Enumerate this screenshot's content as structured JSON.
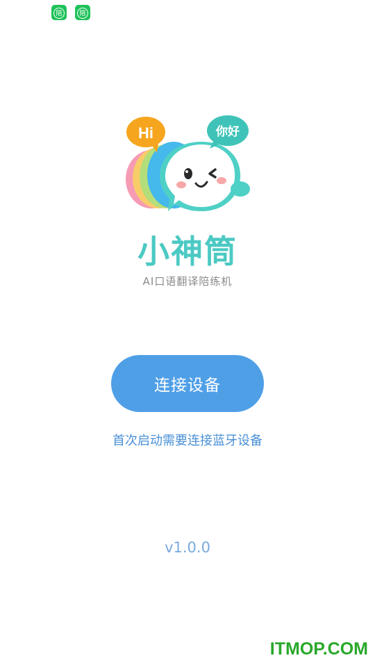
{
  "status_bar": {
    "icons": [
      {
        "name": "app-notification-icon",
        "glyph": "陪"
      },
      {
        "name": "app-notification-icon",
        "glyph": "陪"
      }
    ]
  },
  "brand": {
    "bubble_left_text": "Hi",
    "bubble_right_text": "你好",
    "app_name": "小神筒",
    "tagline": "AI口语翻译陪练机",
    "accent_color": "#4cc9c3"
  },
  "actions": {
    "connect_label": "连接设备",
    "button_color": "#4f9fe7"
  },
  "hint": "首次启动需要连接蓝牙设备",
  "version": "v1.0.0",
  "watermark": "ITMOP.COM"
}
